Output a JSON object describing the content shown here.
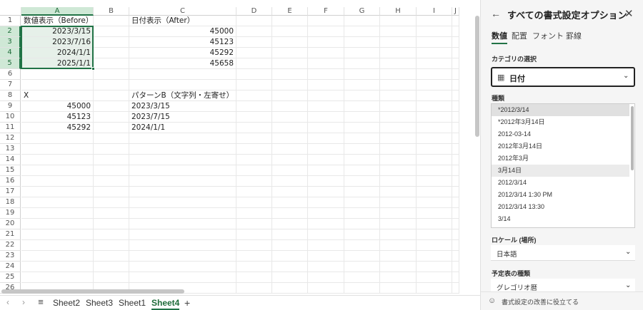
{
  "sheet": {
    "columns": [
      "A",
      "B",
      "C",
      "D",
      "E",
      "F",
      "G",
      "H",
      "I",
      "J"
    ],
    "rows": [
      "1",
      "2",
      "3",
      "4",
      "5",
      "6",
      "7",
      "8",
      "9",
      "10",
      "11",
      "12",
      "13",
      "14",
      "15",
      "16",
      "17",
      "18",
      "19",
      "20",
      "21",
      "22",
      "23",
      "24",
      "25",
      "26"
    ],
    "selected_columns": [
      "A"
    ],
    "selected_rows": [
      "2",
      "3",
      "4",
      "5"
    ],
    "cells": [
      {
        "ref": "A1",
        "value": "数値表示（Before）",
        "align": "left"
      },
      {
        "ref": "C1",
        "value": "日付表示（After）",
        "align": "left"
      },
      {
        "ref": "A2",
        "value": "2023/3/15",
        "align": "right"
      },
      {
        "ref": "C2",
        "value": "45000",
        "align": "right"
      },
      {
        "ref": "A3",
        "value": "2023/7/16",
        "align": "right"
      },
      {
        "ref": "C3",
        "value": "45123",
        "align": "right"
      },
      {
        "ref": "A4",
        "value": "2024/1/1",
        "align": "right"
      },
      {
        "ref": "C4",
        "value": "45292",
        "align": "right"
      },
      {
        "ref": "A5",
        "value": "2025/1/1",
        "align": "right"
      },
      {
        "ref": "C5",
        "value": "45658",
        "align": "right"
      },
      {
        "ref": "A8",
        "value": "X",
        "align": "left"
      },
      {
        "ref": "C8",
        "value": "パターンB（文字列・左寄せ）",
        "align": "left"
      },
      {
        "ref": "A9",
        "value": "45000",
        "align": "right"
      },
      {
        "ref": "C9",
        "value": "2023/3/15",
        "align": "left"
      },
      {
        "ref": "A10",
        "value": "45123",
        "align": "right"
      },
      {
        "ref": "C10",
        "value": "2023/7/15",
        "align": "left"
      },
      {
        "ref": "A11",
        "value": "45292",
        "align": "right"
      },
      {
        "ref": "C11",
        "value": "2024/1/1",
        "align": "left"
      }
    ],
    "accent_color": "#217346"
  },
  "tabs": {
    "nav_prev_icon": "chevron-left-icon",
    "nav_next_icon": "chevron-right-icon",
    "menu_icon": "hamburger-icon",
    "sheets": [
      "Sheet2",
      "Sheet3",
      "Sheet1",
      "Sheet4"
    ],
    "active_sheet": "Sheet4",
    "add_label": "+"
  },
  "pane": {
    "title": "すべての書式設定オプション",
    "tabs": [
      {
        "label": "数値",
        "active": true
      },
      {
        "label": "配置",
        "active": false
      },
      {
        "label": "フォント",
        "active": false
      },
      {
        "label": "罫線",
        "active": false
      }
    ],
    "category_label": "カテゴリの選択",
    "category_value": "日付",
    "type_label": "種類",
    "types": [
      "*2012/3/14",
      "*2012年3月14日",
      "2012-03-14",
      "2012年3月14日",
      "2012年3月",
      "3月14日",
      "2012/3/14",
      "2012/3/14 1:30 PM",
      "2012/3/14 13:30",
      "3/14"
    ],
    "selected_type_index": 0,
    "hover_type_index": 5,
    "locale_label": "ロケール (場所)",
    "locale_value": "日本語",
    "calendar_label": "予定表の種類",
    "calendar_value": "グレゴリオ暦",
    "footer_text": "書式設定の改善に役立てる"
  }
}
